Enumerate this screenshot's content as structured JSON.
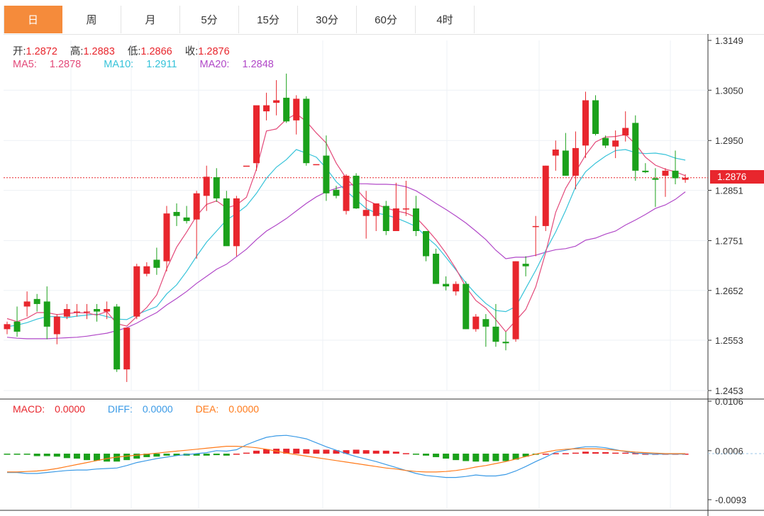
{
  "tabs": [
    "日",
    "周",
    "月",
    "5分",
    "15分",
    "30分",
    "60分",
    "4时"
  ],
  "active_tab": 0,
  "ohlc": {
    "open_label": "开:",
    "open": "1.2872",
    "high_label": "高:",
    "high": "1.2883",
    "low_label": "低:",
    "low": "1.2866",
    "close_label": "收:",
    "close": "1.2876"
  },
  "ma": {
    "ma5_label": "MA5:",
    "ma5": "1.2878",
    "ma10_label": "MA10:",
    "ma10": "1.2911",
    "ma20_label": "MA20:",
    "ma20": "1.2848"
  },
  "macd": {
    "macd_label": "MACD:",
    "macd": "0.0000",
    "diff_label": "DIFF:",
    "diff": "0.0000",
    "dea_label": "DEA:",
    "dea": "0.0000"
  },
  "price_tag": "1.2876",
  "colors": {
    "up": "#e8262d",
    "down": "#1ba11b",
    "ma5": "#e34a7a",
    "ma10": "#36c3d9",
    "ma20": "#b148c8",
    "diff": "#3a9ae6",
    "dea": "#ff7a1a",
    "tab_active": "#f58b3b"
  },
  "chart_data": [
    {
      "type": "candlestick",
      "y_ticks": [
        "1.3149",
        "1.3050",
        "1.2950",
        "1.2851",
        "1.2751",
        "1.2652",
        "1.2553",
        "1.2453"
      ],
      "ylim": [
        1.2453,
        1.3149
      ],
      "last_price": 1.2876,
      "candles": [
        [
          1.2575,
          1.259,
          1.2565,
          1.2585
        ],
        [
          1.259,
          1.262,
          1.256,
          1.257
        ],
        [
          1.262,
          1.265,
          1.26,
          1.263
        ],
        [
          1.2635,
          1.2645,
          1.261,
          1.2625
        ],
        [
          1.263,
          1.266,
          1.2555,
          1.258
        ],
        [
          1.2565,
          1.2605,
          1.2545,
          1.26
        ],
        [
          1.26,
          1.2625,
          1.2595,
          1.2615
        ],
        [
          1.2608,
          1.2625,
          1.26,
          1.261
        ],
        [
          1.261,
          1.2625,
          1.2595,
          1.261
        ],
        [
          1.2615,
          1.2625,
          1.259,
          1.261
        ],
        [
          1.261,
          1.263,
          1.2595,
          1.2615
        ],
        [
          1.262,
          1.2625,
          1.249,
          1.2495
        ],
        [
          1.2495,
          1.2575,
          1.247,
          1.2578
        ],
        [
          1.26,
          1.2705,
          1.2595,
          1.27
        ],
        [
          1.2685,
          1.2708,
          1.268,
          1.27
        ],
        [
          1.2713,
          1.2737,
          1.2683,
          1.2697
        ],
        [
          1.271,
          1.282,
          1.269,
          1.2805
        ],
        [
          1.2808,
          1.2825,
          1.278,
          1.28
        ],
        [
          1.2797,
          1.282,
          1.2785,
          1.279
        ],
        [
          1.2793,
          1.285,
          1.2715,
          1.2845
        ],
        [
          1.284,
          1.29,
          1.281,
          1.2878
        ],
        [
          1.2877,
          1.2895,
          1.2828,
          1.2835
        ],
        [
          1.2835,
          1.285,
          1.276,
          1.274
        ],
        [
          1.274,
          1.284,
          1.272,
          1.2835
        ],
        [
          1.29,
          1.29,
          1.29,
          1.29
        ],
        [
          1.2905,
          1.3,
          1.289,
          1.302
        ],
        [
          1.3008,
          1.3045,
          1.299,
          1.302
        ],
        [
          1.3025,
          1.307,
          1.3,
          1.303
        ],
        [
          1.3035,
          1.3083,
          1.2985,
          1.2988
        ],
        [
          1.299,
          1.304,
          1.2962,
          1.3033
        ],
        [
          1.3033,
          1.3038,
          1.29,
          1.2905
        ],
        [
          1.2903,
          1.2903,
          1.2903,
          1.2903
        ],
        [
          1.292,
          1.296,
          1.283,
          1.2845
        ],
        [
          1.2852,
          1.286,
          1.2835,
          1.284
        ],
        [
          1.281,
          1.2883,
          1.2803,
          1.288
        ],
        [
          1.288,
          1.2885,
          1.2814,
          1.2815
        ],
        [
          1.28,
          1.285,
          1.2755,
          1.2812
        ],
        [
          1.28,
          1.2815,
          1.277,
          1.2825
        ],
        [
          1.282,
          1.283,
          1.2762,
          1.277
        ],
        [
          1.277,
          1.2866,
          1.277,
          1.2815
        ],
        [
          1.2815,
          1.287,
          1.28,
          1.2815
        ],
        [
          1.2815,
          1.284,
          1.276,
          1.277
        ],
        [
          1.277,
          1.277,
          1.271,
          1.272
        ],
        [
          1.2725,
          1.2735,
          1.267,
          1.2665
        ],
        [
          1.2665,
          1.268,
          1.2652,
          1.266
        ],
        [
          1.265,
          1.267,
          1.2642,
          1.2665
        ],
        [
          1.2665,
          1.267,
          1.2575,
          1.2575
        ],
        [
          1.2575,
          1.2605,
          1.257,
          1.26
        ],
        [
          1.2595,
          1.2605,
          1.254,
          1.258
        ],
        [
          1.258,
          1.2625,
          1.254,
          1.255
        ],
        [
          1.255,
          1.257,
          1.2533,
          1.2547
        ],
        [
          1.2555,
          1.271,
          1.255,
          1.271
        ],
        [
          1.2705,
          1.272,
          1.268,
          1.27
        ],
        [
          1.278,
          1.28,
          1.272,
          1.278
        ],
        [
          1.278,
          1.29,
          1.277,
          1.29
        ],
        [
          1.292,
          1.295,
          1.289,
          1.2932
        ],
        [
          1.293,
          1.2965,
          1.288,
          1.288
        ],
        [
          1.288,
          1.2968,
          1.2853,
          1.2935
        ],
        [
          1.294,
          1.3047,
          1.2915,
          1.303
        ],
        [
          1.303,
          1.304,
          1.296,
          1.2963
        ],
        [
          1.2955,
          1.296,
          1.2935,
          1.294
        ],
        [
          1.2938,
          1.297,
          1.2915,
          1.295
        ],
        [
          1.296,
          1.3008,
          1.2948,
          1.2975
        ],
        [
          1.2985,
          1.3,
          1.287,
          1.289
        ],
        [
          1.289,
          1.2905,
          1.2885,
          1.2887
        ],
        [
          1.2875,
          1.2895,
          1.2818,
          1.2872
        ],
        [
          1.288,
          1.2895,
          1.2838,
          1.289
        ],
        [
          1.289,
          1.293,
          1.2863,
          1.2875
        ],
        [
          1.2872,
          1.2883,
          1.2866,
          1.2876
        ]
      ],
      "ma5": [
        1.2596,
        1.259,
        1.2597,
        1.2608,
        1.2608,
        1.2604,
        1.2606,
        1.2608,
        1.2607,
        1.2603,
        1.261,
        1.2586,
        1.2581,
        1.26,
        1.2618,
        1.2643,
        1.2695,
        1.2738,
        1.2768,
        1.28,
        1.2823,
        1.283,
        1.2816,
        1.2822,
        1.2837,
        1.2893,
        1.2969,
        1.2973,
        1.2992,
        1.3003,
        1.2988,
        1.2965,
        1.2945,
        1.2905,
        1.2875,
        1.2854,
        1.2832,
        1.2823,
        1.2816,
        1.281,
        1.2806,
        1.2797,
        1.2776,
        1.2753,
        1.2726,
        1.2695,
        1.2659,
        1.2632,
        1.2617,
        1.2594,
        1.257,
        1.2592,
        1.2614,
        1.2659,
        1.2727,
        1.2807,
        1.2855,
        1.2888,
        1.2921,
        1.2947,
        1.2957,
        1.2958,
        1.2962,
        1.2943,
        1.2917,
        1.2901,
        1.2893,
        1.2888,
        1.288
      ],
      "ma10": [
        1.258,
        1.2583,
        1.2588,
        1.2595,
        1.26,
        1.26,
        1.2598,
        1.2601,
        1.2603,
        1.2605,
        1.26,
        1.2595,
        1.2594,
        1.2604,
        1.2612,
        1.262,
        1.2645,
        1.2663,
        1.269,
        1.272,
        1.2748,
        1.277,
        1.2792,
        1.2805,
        1.282,
        1.2845,
        1.2875,
        1.2897,
        1.2912,
        1.2932,
        1.2925,
        1.2917,
        1.2895,
        1.2868,
        1.285,
        1.2832,
        1.2815,
        1.2806,
        1.2802,
        1.2796,
        1.2788,
        1.2779,
        1.2759,
        1.2742,
        1.2718,
        1.2693,
        1.2667,
        1.2645,
        1.2626,
        1.2612,
        1.261,
        1.262,
        1.2656,
        1.2692,
        1.2731,
        1.2768,
        1.2811,
        1.2858,
        1.2888,
        1.2905,
        1.2919,
        1.293,
        1.2932,
        1.2926,
        1.2924,
        1.2925,
        1.2922,
        1.2915,
        1.2911
      ],
      "ma20": [
        1.2559,
        1.2557,
        1.2556,
        1.2556,
        1.2556,
        1.2557,
        1.2558,
        1.2559,
        1.2561,
        1.2564,
        1.2567,
        1.2572,
        1.2578,
        1.2587,
        1.2598,
        1.2608,
        1.2623,
        1.2636,
        1.265,
        1.2666,
        1.268,
        1.2694,
        1.2704,
        1.2719,
        1.2734,
        1.2753,
        1.277,
        1.2782,
        1.2795,
        1.281,
        1.2825,
        1.2838,
        1.2848,
        1.2855,
        1.286,
        1.2864,
        1.2864,
        1.2863,
        1.2863,
        1.2862,
        1.2858,
        1.285,
        1.2838,
        1.2825,
        1.2813,
        1.28,
        1.2786,
        1.277,
        1.2753,
        1.2732,
        1.2715,
        1.2718,
        1.2718,
        1.2722,
        1.2728,
        1.2733,
        1.2735,
        1.274,
        1.2752,
        1.2756,
        1.2764,
        1.277,
        1.2782,
        1.2792,
        1.2803,
        1.2815,
        1.2822,
        1.2833,
        1.2848
      ]
    },
    {
      "type": "bar",
      "title": "MACD",
      "y_ticks": [
        "0.0106",
        "0.0006",
        "-0.0093"
      ],
      "ylim": [
        -0.0093,
        0.0106
      ],
      "histogram": [
        -0.0001,
        -0.0001,
        -0.0002,
        -0.0005,
        -0.0005,
        -0.0006,
        -0.0009,
        -0.001,
        -0.0013,
        -0.0014,
        -0.0016,
        -0.0016,
        -0.0013,
        -0.001,
        -0.0007,
        -0.0006,
        -0.0004,
        -0.0004,
        -0.0004,
        -0.0004,
        -0.0004,
        -0.0003,
        -0.0004,
        0.0,
        0.0002,
        0.0006,
        0.0009,
        0.001,
        0.001,
        0.001,
        0.0009,
        0.0008,
        0.0008,
        0.0007,
        0.0007,
        0.0008,
        0.0007,
        0.0006,
        0.0006,
        0.0004,
        0.0001,
        -0.0001,
        -0.0004,
        -0.0007,
        -0.001,
        -0.0013,
        -0.0015,
        -0.0016,
        -0.0016,
        -0.0015,
        -0.0015,
        -0.0012,
        -0.0006,
        -0.0002,
        0.0,
        0.0001,
        0.0001,
        0.0002,
        0.0004,
        0.0003,
        0.0003,
        0.0002,
        0.0002,
        0.0001,
        0.0,
        0.0,
        0.0,
        0.0,
        0.0
      ],
      "diff": [
        -0.0038,
        -0.0038,
        -0.004,
        -0.004,
        -0.0038,
        -0.0036,
        -0.0034,
        -0.0033,
        -0.0033,
        -0.0031,
        -0.003,
        -0.0029,
        -0.0024,
        -0.0018,
        -0.0014,
        -0.001,
        -0.0007,
        -0.0004,
        -0.0002,
        0.0,
        0.0002,
        0.0006,
        0.0005,
        0.0008,
        0.0018,
        0.0026,
        0.0033,
        0.0036,
        0.0037,
        0.0034,
        0.003,
        0.0022,
        0.0014,
        0.0007,
        0.0,
        -0.0006,
        -0.0011,
        -0.0016,
        -0.0022,
        -0.0028,
        -0.0034,
        -0.004,
        -0.0044,
        -0.0046,
        -0.0048,
        -0.0048,
        -0.0046,
        -0.0043,
        -0.0045,
        -0.0045,
        -0.0042,
        -0.0035,
        -0.0026,
        -0.0016,
        -0.0007,
        0.0003,
        0.0007,
        0.0011,
        0.0014,
        0.0014,
        0.0012,
        0.0008,
        0.0004,
        0.0001,
        0.0,
        -0.0001,
        -0.0001,
        -0.0001,
        -0.0001
      ],
      "dea": [
        -0.0037,
        -0.0037,
        -0.0036,
        -0.0035,
        -0.0033,
        -0.003,
        -0.0026,
        -0.0022,
        -0.0018,
        -0.0014,
        -0.001,
        -0.0007,
        -0.0005,
        -0.0003,
        -0.0001,
        0.0001,
        0.0003,
        0.0005,
        0.0007,
        0.0009,
        0.0011,
        0.0013,
        0.0015,
        0.0015,
        0.0014,
        0.0012,
        0.0009,
        0.0005,
        0.0001,
        -0.0002,
        -0.0005,
        -0.0008,
        -0.0011,
        -0.0014,
        -0.0017,
        -0.002,
        -0.0023,
        -0.0026,
        -0.0029,
        -0.0031,
        -0.0034,
        -0.0036,
        -0.0037,
        -0.0037,
        -0.0036,
        -0.0034,
        -0.0031,
        -0.0027,
        -0.0024,
        -0.002,
        -0.0016,
        -0.0011,
        -0.0006,
        -0.0001,
        0.0003,
        0.0007,
        0.0009,
        0.001,
        0.001,
        0.001,
        0.0009,
        0.0007,
        0.0005,
        0.0003,
        0.0002,
        0.0001,
        0.0,
        0.0,
        0.0
      ]
    }
  ]
}
